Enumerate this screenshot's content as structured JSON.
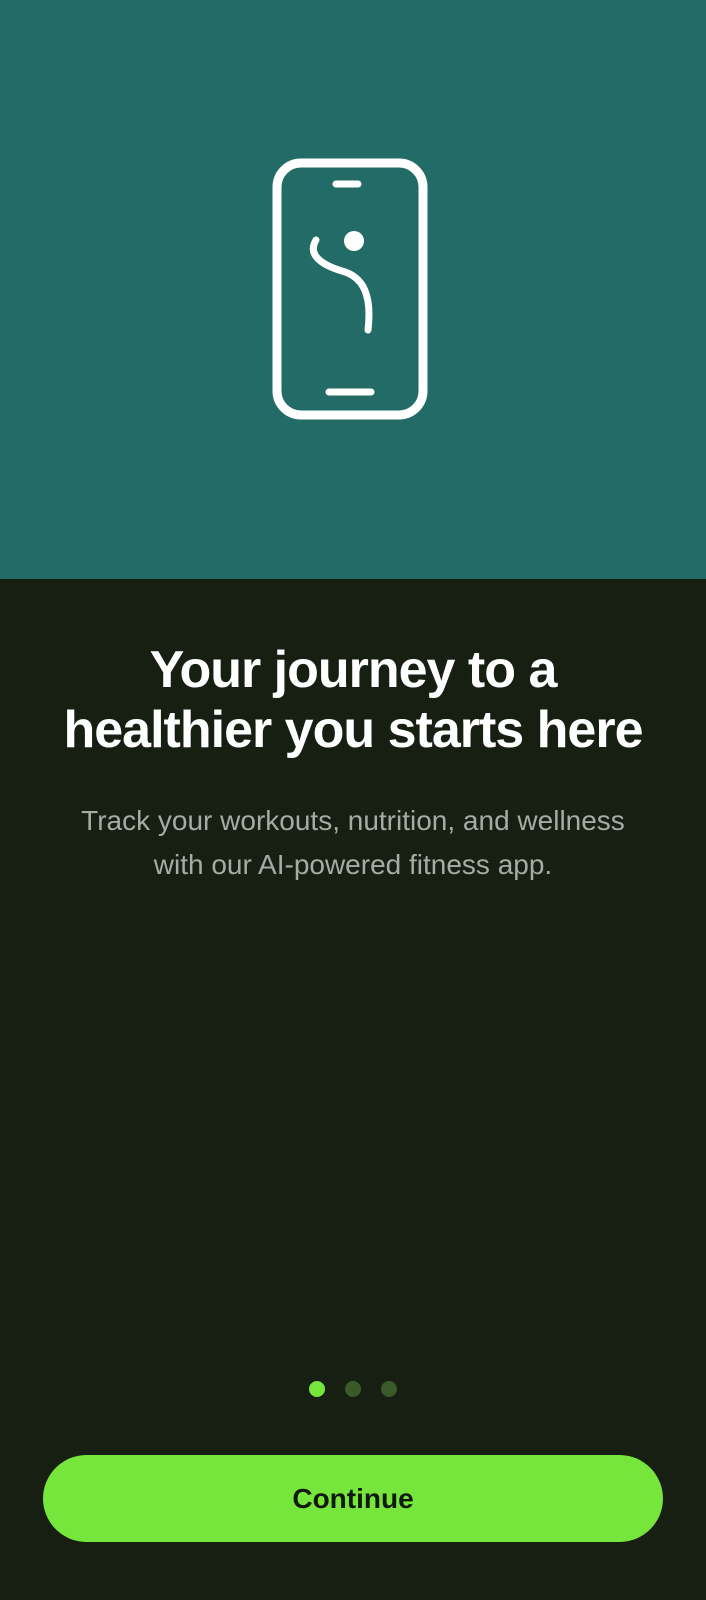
{
  "colors": {
    "hero_background": "#236b66",
    "page_background": "#171f13",
    "accent": "#76e63d",
    "dot_active": "#76e63d",
    "dot_inactive": "#3b5a2a",
    "title_text": "#ffffff",
    "subtitle_text": "#a6aba5",
    "button_text": "#101a0c"
  },
  "hero": {
    "icon": "phone-fitness-figure-icon"
  },
  "onboarding": {
    "title_lines": [
      "Your journey to a",
      "healthier you starts here"
    ],
    "subtitle_lines": [
      "Track your workouts, nutrition, and wellness",
      "with our AI-powered fitness app."
    ]
  },
  "pager": {
    "total_pages": 3,
    "current_page": 1
  },
  "actions": {
    "continue_label": "Continue"
  }
}
